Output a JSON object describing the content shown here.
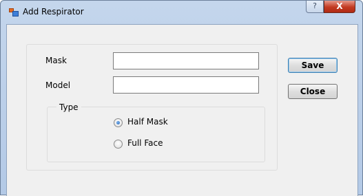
{
  "window": {
    "title": "Add Respirator",
    "help_glyph": "?",
    "close_glyph": "X"
  },
  "form": {
    "mask_label": "Mask",
    "mask_value": "",
    "model_label": "Model",
    "model_value": "",
    "type_group_label": "Type",
    "type_options": [
      {
        "label": "Half Mask",
        "selected": true
      },
      {
        "label": "Full Face",
        "selected": false
      }
    ]
  },
  "buttons": {
    "save_label": "Save",
    "close_label": "Close"
  },
  "colors": {
    "title_bar": "#c4d6ec",
    "client_bg": "#f0f0f0",
    "close_button": "#c23a22",
    "radio_dot": "#1e5fb4"
  }
}
